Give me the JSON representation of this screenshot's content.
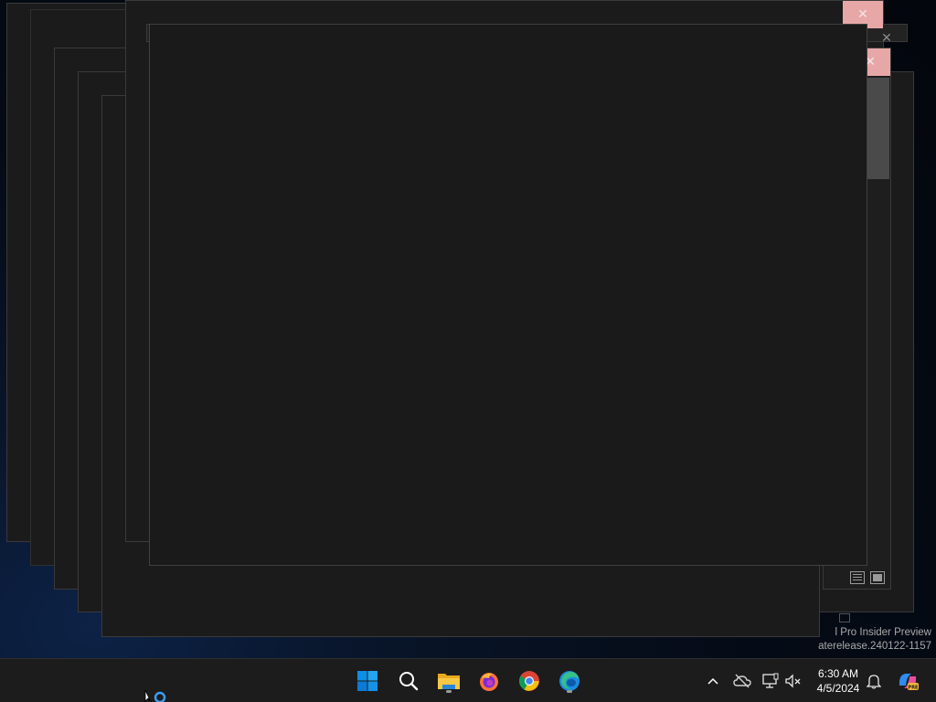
{
  "desktop": {
    "watermark_line1": "l Pro Insider Preview",
    "watermark_line2": "aterelease.240122-1157",
    "close_glyph": "✕"
  },
  "taskbar": {
    "pinned": [
      {
        "name": "start-button",
        "icon": "windows-logo-icon"
      },
      {
        "name": "search-button",
        "icon": "search-icon"
      },
      {
        "name": "file-explorer-button",
        "icon": "folder-icon",
        "running": true
      },
      {
        "name": "firefox-button",
        "icon": "firefox-icon"
      },
      {
        "name": "chrome-button",
        "icon": "chrome-icon"
      },
      {
        "name": "edge-button",
        "icon": "edge-icon",
        "running": true
      }
    ],
    "tray": {
      "chevron": "^",
      "time": "6:30 AM",
      "date": "4/5/2024"
    }
  },
  "colors": {
    "accent": "#0078d4",
    "close_button": "#e8a7a7",
    "taskbar": "#1c1c1c",
    "window_bg": "#1b1b1b"
  }
}
